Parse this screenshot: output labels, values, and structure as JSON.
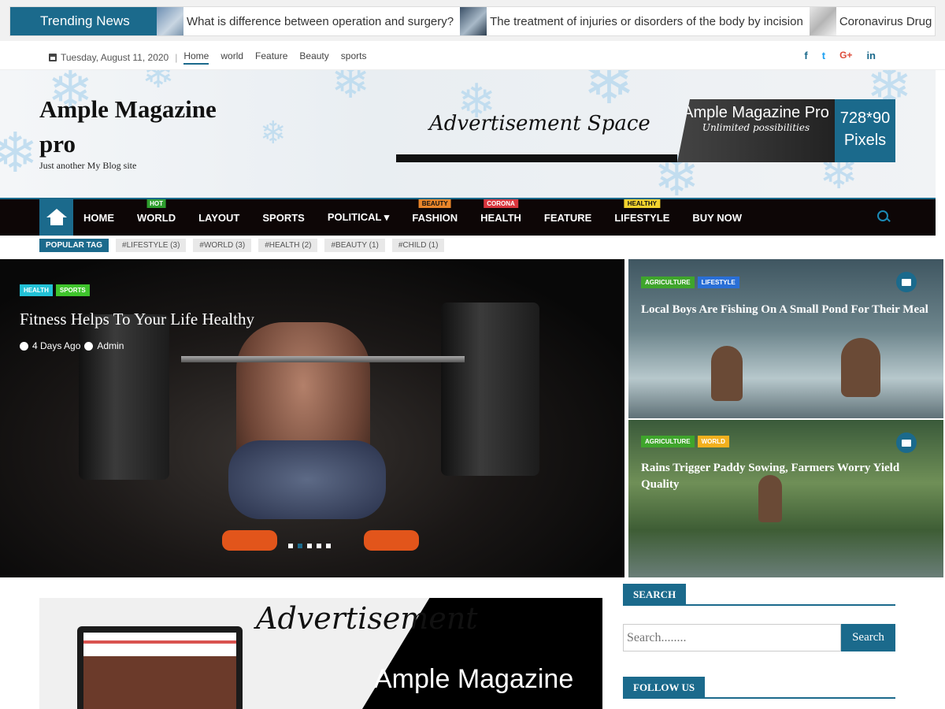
{
  "trending": {
    "label": "Trending News",
    "items": [
      {
        "text": "What is difference between operation and surgery?"
      },
      {
        "text": "The treatment of injuries or disorders of the body by incision"
      },
      {
        "text": "Coronavirus Drug"
      }
    ]
  },
  "topbar": {
    "date": "Tuesday, August 11, 2020",
    "links": [
      "Home",
      "world",
      "Feature",
      "Beauty",
      "sports"
    ],
    "socials": [
      "f",
      "t",
      "G+",
      "in"
    ]
  },
  "header": {
    "site_title": "Ample Magazine pro",
    "tagline": "Just another My Blog site",
    "ad": {
      "script": "Advertisement Space",
      "brand": "Ample Magazine Pro",
      "slogan": "Unlimited possibilities",
      "size": "728*90 Pixels"
    }
  },
  "nav": {
    "items": [
      {
        "label": "HOME",
        "badge": ""
      },
      {
        "label": "WORLD",
        "badge": "HOT",
        "badge_color": "#2e9e2e"
      },
      {
        "label": "LAYOUT",
        "badge": ""
      },
      {
        "label": "SPORTS",
        "badge": ""
      },
      {
        "label": "POLITICAL ▾",
        "badge": ""
      },
      {
        "label": "FASHION",
        "badge": "BEAUTY",
        "badge_color": "#e8852a"
      },
      {
        "label": "HEALTH",
        "badge": "CORONA",
        "badge_color": "#d9363e"
      },
      {
        "label": "FEATURE",
        "badge": ""
      },
      {
        "label": "LIFESTYLE",
        "badge": "HEALTHY",
        "badge_color": "#f2d22e"
      },
      {
        "label": "BUY NOW",
        "badge": ""
      }
    ]
  },
  "tags": {
    "label": "POPULAR TAG",
    "items": [
      "#LIFESTYLE (3)",
      "#WORLD (3)",
      "#HEALTH (2)",
      "#BEAUTY (1)",
      "#CHILD (1)"
    ]
  },
  "hero": {
    "categories": [
      {
        "label": "HEALTH",
        "color": "#22c1d6"
      },
      {
        "label": "SPORTS",
        "color": "#3fc42c"
      }
    ],
    "title": "Fitness Helps To Your Life Healthy",
    "time": "4 Days Ago",
    "author": "Admin",
    "slides": 5,
    "active_slide": 2
  },
  "side_cards": [
    {
      "categories": [
        {
          "label": "AGRICULTURE",
          "color": "#3fa52c"
        },
        {
          "label": "LIFESTYLE",
          "color": "#2a6fd6"
        }
      ],
      "title": "Local Boys Are Fishing On A Small Pond For Their Meal",
      "icon": "image-icon"
    },
    {
      "categories": [
        {
          "label": "AGRICULTURE",
          "color": "#3fa52c"
        },
        {
          "label": "WORLD",
          "color": "#f2b01e"
        }
      ],
      "title": "Rains Trigger Paddy Sowing, Farmers Worry Yield Quality",
      "icon": "video-icon"
    }
  ],
  "ad_bottom": {
    "script": "Advertisement",
    "brand": "Ample Magazine"
  },
  "sidebar": {
    "search_title": "SEARCH",
    "search_placeholder": "Search........",
    "search_button": "Search",
    "follow_title": "FOLLOW US"
  },
  "colors": {
    "accent": "#1b6a8c",
    "nav_bg": "#0d0606"
  }
}
